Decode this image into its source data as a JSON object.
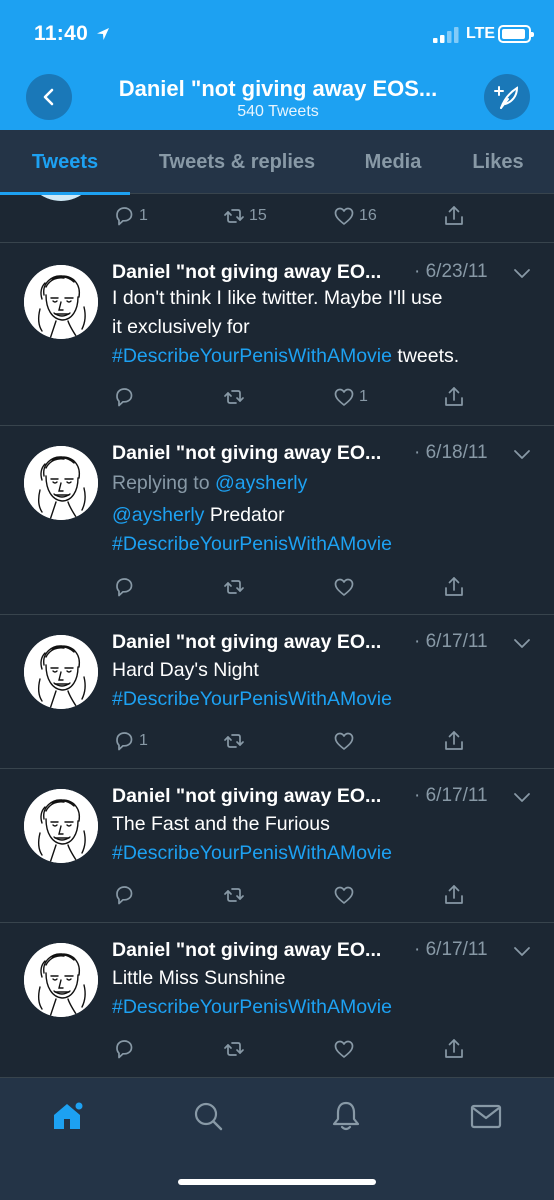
{
  "status_bar": {
    "time": "11:40",
    "network": "LTE",
    "icons": [
      "location-arrow-icon",
      "signal-icon",
      "battery-icon"
    ]
  },
  "header": {
    "title": "Daniel \"not giving away EOS...",
    "subtitle": "540 Tweets",
    "back_icon": "chevron-left-icon",
    "compose_icon": "compose-feather-icon"
  },
  "tabs": [
    {
      "label": "Tweets",
      "active": true
    },
    {
      "label": "Tweets & replies",
      "active": false
    },
    {
      "label": "Media",
      "active": false
    },
    {
      "label": "Likes",
      "active": false
    }
  ],
  "partial_tweet": {
    "replies": "1",
    "retweets": "15",
    "likes": "16"
  },
  "tweets": [
    {
      "name": "Daniel \"not giving away EO...",
      "date": "· 6/23/11",
      "text_line1": "I don't think I like twitter. Maybe I'll use",
      "text_line2": "it exclusively for",
      "hashtag": "#DescribeYourPenisWithAMovie",
      "text_after": " tweets.",
      "replies": "",
      "retweets": "",
      "likes": "1"
    },
    {
      "name": "Daniel \"not giving away EO...",
      "date": "· 6/18/11",
      "reply_prefix": "Replying to ",
      "reply_to": "@aysherly",
      "mention": "@aysherly",
      "text": " Predator",
      "hashtag": "#DescribeYourPenisWithAMovie",
      "replies": "",
      "retweets": "",
      "likes": ""
    },
    {
      "name": "Daniel \"not giving away EO...",
      "date": "· 6/17/11",
      "text": "Hard Day's Night",
      "hashtag": "#DescribeYourPenisWithAMovie",
      "replies": "1",
      "retweets": "",
      "likes": ""
    },
    {
      "name": "Daniel \"not giving away EO...",
      "date": "· 6/17/11",
      "text": "The Fast and the Furious",
      "hashtag": "#DescribeYourPenisWithAMovie",
      "replies": "",
      "retweets": "",
      "likes": ""
    },
    {
      "name": "Daniel \"not giving away EO...",
      "date": "· 6/17/11",
      "text": "Little Miss Sunshine",
      "hashtag": "#DescribeYourPenisWithAMovie",
      "replies": "",
      "retweets": "",
      "likes": ""
    }
  ],
  "bottom_nav": [
    {
      "icon": "home-icon",
      "active": true
    },
    {
      "icon": "search-icon",
      "active": false
    },
    {
      "icon": "notifications-bell-icon",
      "active": false
    },
    {
      "icon": "messages-envelope-icon",
      "active": false
    }
  ],
  "colors": {
    "accent": "#1da1f2",
    "background": "#1c2733",
    "bar": "#243447",
    "muted": "#8899a6",
    "divider": "#38444d"
  }
}
